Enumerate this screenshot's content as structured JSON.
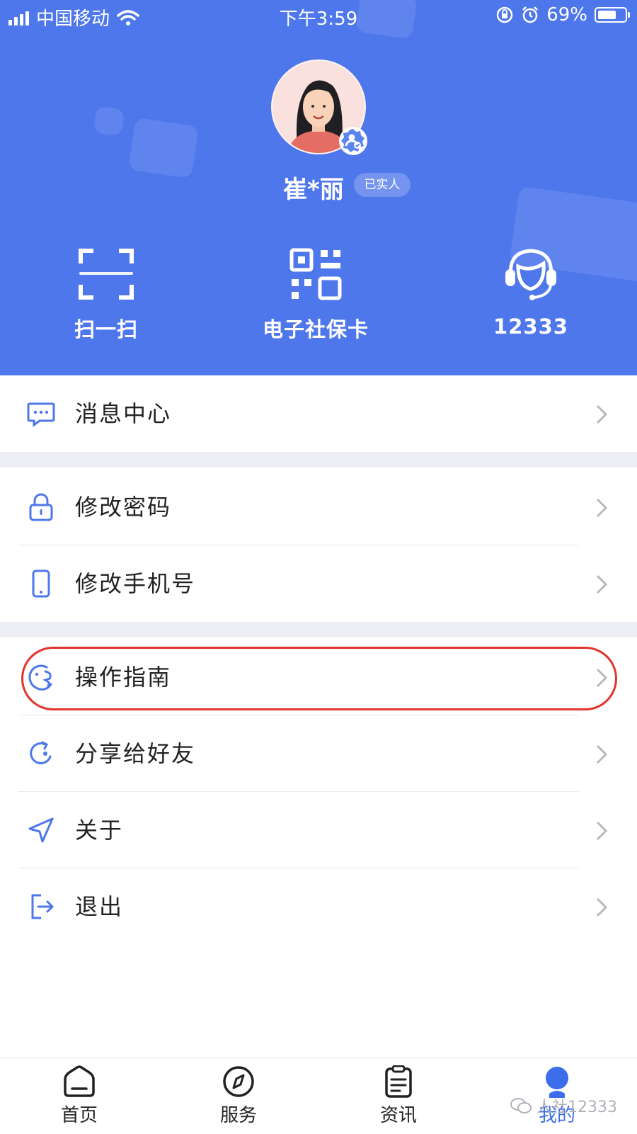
{
  "status_bar": {
    "carrier": "中国移动",
    "time": "下午3:59",
    "battery": "69%",
    "battery_level": 0.69
  },
  "profile": {
    "name": "崔*丽",
    "verified_label": "已实人"
  },
  "quick_actions": [
    {
      "label": "扫一扫",
      "icon": "scan-icon"
    },
    {
      "label": "电子社保卡",
      "icon": "qr-code-icon"
    },
    {
      "label": "12333",
      "icon": "customer-service-icon"
    }
  ],
  "menu": {
    "message_center": "消息中心",
    "change_password": "修改密码",
    "change_phone": "修改手机号",
    "guide": "操作指南",
    "share": "分享给好友",
    "about": "关于",
    "logout": "退出"
  },
  "tabs": [
    {
      "label": "首页",
      "icon": "home-icon"
    },
    {
      "label": "服务",
      "icon": "compass-icon"
    },
    {
      "label": "资讯",
      "icon": "news-icon"
    },
    {
      "label": "我的",
      "icon": "profile-icon",
      "active": true
    }
  ],
  "watermark": "人社12333",
  "colors": {
    "header_bg": "#4f77ec",
    "accent": "#3c6eea",
    "highlight": "#e0352b"
  }
}
